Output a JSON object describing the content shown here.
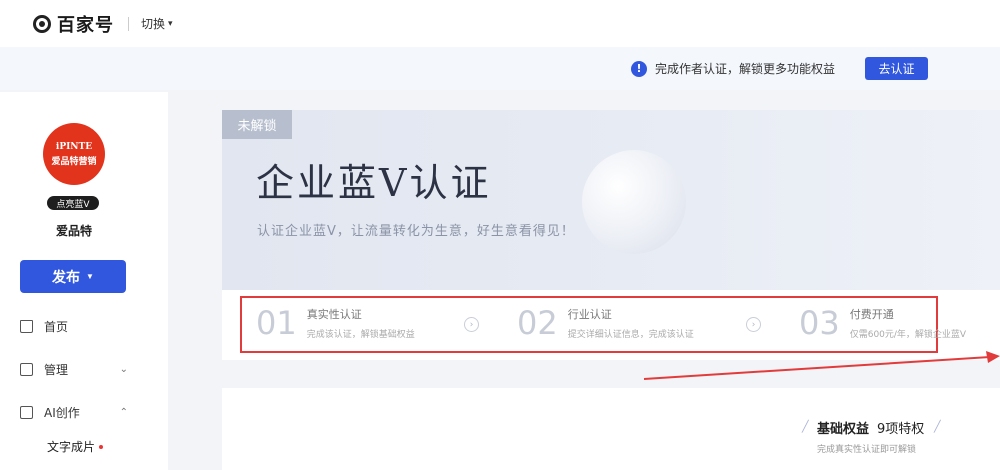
{
  "topbar": {
    "logo_text": "百家号",
    "switch_label": "切换"
  },
  "notice": {
    "text": "完成作者认证，解锁更多功能权益",
    "button": "去认证",
    "icon_char": "!"
  },
  "sidebar": {
    "avatar_line1": "iPINTE",
    "avatar_line2": "爱品特营销",
    "badge": "点亮蓝V",
    "username": "爱品特",
    "publish_label": "发布",
    "nav": [
      {
        "label": "首页"
      },
      {
        "label": "管理"
      },
      {
        "label": "AI创作"
      }
    ],
    "sub_item": "文字成片"
  },
  "hero": {
    "tag": "未解锁",
    "title": "企业蓝V认证",
    "subtitle": "认证企业蓝V，让流量转化为生意，好生意看得见！"
  },
  "steps": [
    {
      "num": "01",
      "title": "真实性认证",
      "desc": "完成该认证，解锁基础权益"
    },
    {
      "num": "02",
      "title": "行业认证",
      "desc": "提交详细认证信息，完成该认证"
    },
    {
      "num": "03",
      "title": "付费开通",
      "desc": "仅需600元/年，解锁企业蓝V"
    }
  ],
  "benefits": {
    "title": "基础权益",
    "count": "9项特权",
    "subtitle": "完成真实性认证即可解锁"
  },
  "colors": {
    "accent": "#3157de",
    "annotation_red": "#e23b3b"
  }
}
